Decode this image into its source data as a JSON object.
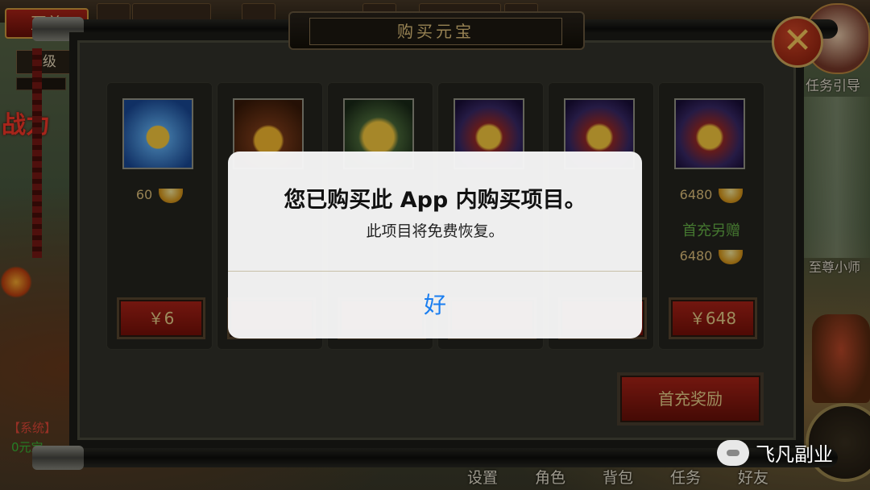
{
  "hud": {
    "top_left_button": "至尊",
    "level": "1级",
    "power_label": "战力",
    "guide_label": "任务引导",
    "right_character_label": "至尊小师",
    "chat_system": "【系统】",
    "chat_line": "0元宝"
  },
  "panel": {
    "title": "购买元宝",
    "close_symbol": "✕"
  },
  "products": [
    {
      "amount": "60",
      "price": "￥6",
      "icon": "ingot-icon"
    },
    {
      "amount": "",
      "price": "",
      "icon": "ingot-pile-icon"
    },
    {
      "amount": "",
      "price": "",
      "icon": "ingot-stack-icon"
    },
    {
      "amount": "",
      "price": "",
      "icon": "treasure-chest-icon"
    },
    {
      "amount": "",
      "price": "",
      "icon": "treasure-chest-icon"
    },
    {
      "amount": "6480",
      "bonus_label": "首充另赠",
      "bonus_amount": "6480",
      "price": "￥648",
      "icon": "treasure-chest-icon"
    }
  ],
  "first_charge_button": "首充奖励",
  "bottom_menu": [
    "设置",
    "角色",
    "背包",
    "任务",
    "好友"
  ],
  "watermark": "飞凡副业",
  "alert": {
    "title": "您已购买此 App 内购买项目。",
    "message": "此项目将免费恢复。",
    "ok_label": "好",
    "link_color": "#1a7ef0"
  }
}
